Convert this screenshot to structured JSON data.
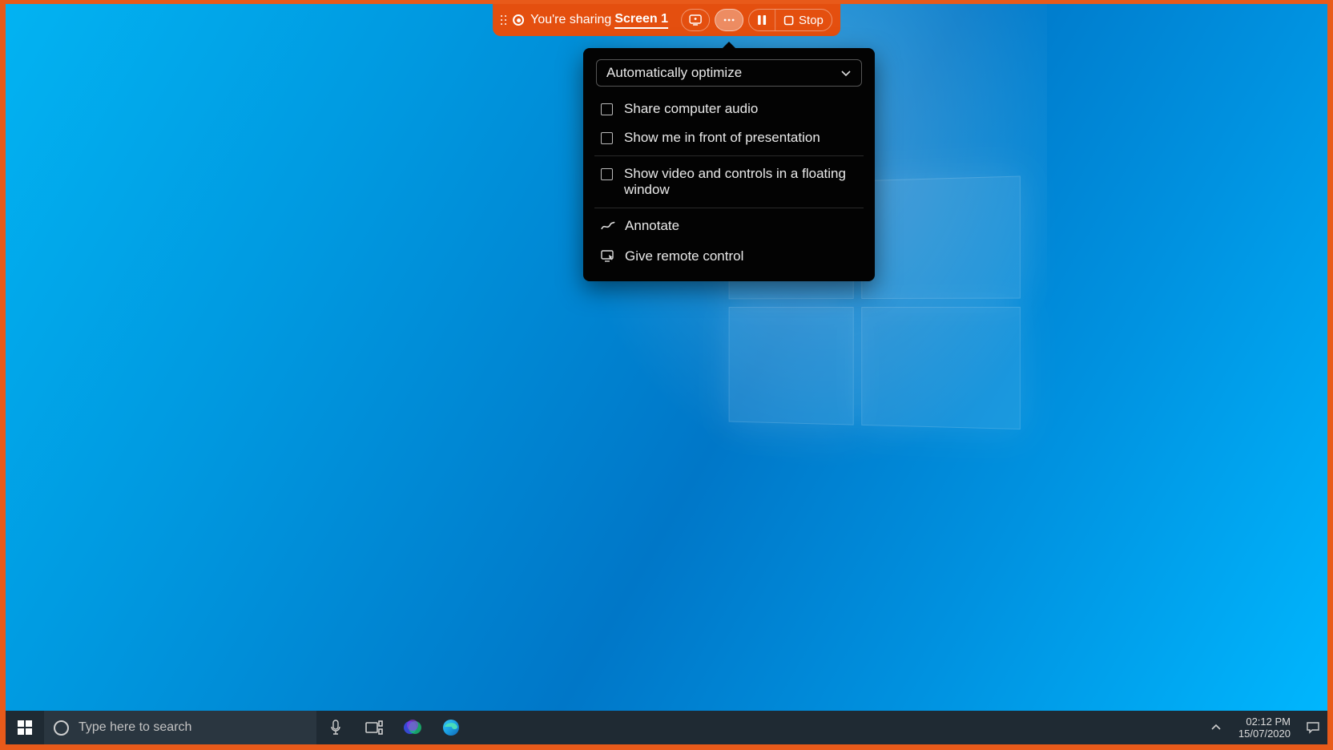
{
  "sharebar": {
    "status_text": "You're sharing",
    "screen_label": "Screen 1",
    "stop_label": "Stop"
  },
  "panel": {
    "select_label": "Automatically optimize",
    "checkbox_share_audio": "Share computer audio",
    "checkbox_show_me": "Show me in front of presentation",
    "checkbox_floating": "Show video and controls in a floating window",
    "annotate_label": "Annotate",
    "remote_label": "Give remote control"
  },
  "taskbar": {
    "search_placeholder": "Type here to search",
    "time": "02:12 PM",
    "date": "15/07/2020"
  }
}
